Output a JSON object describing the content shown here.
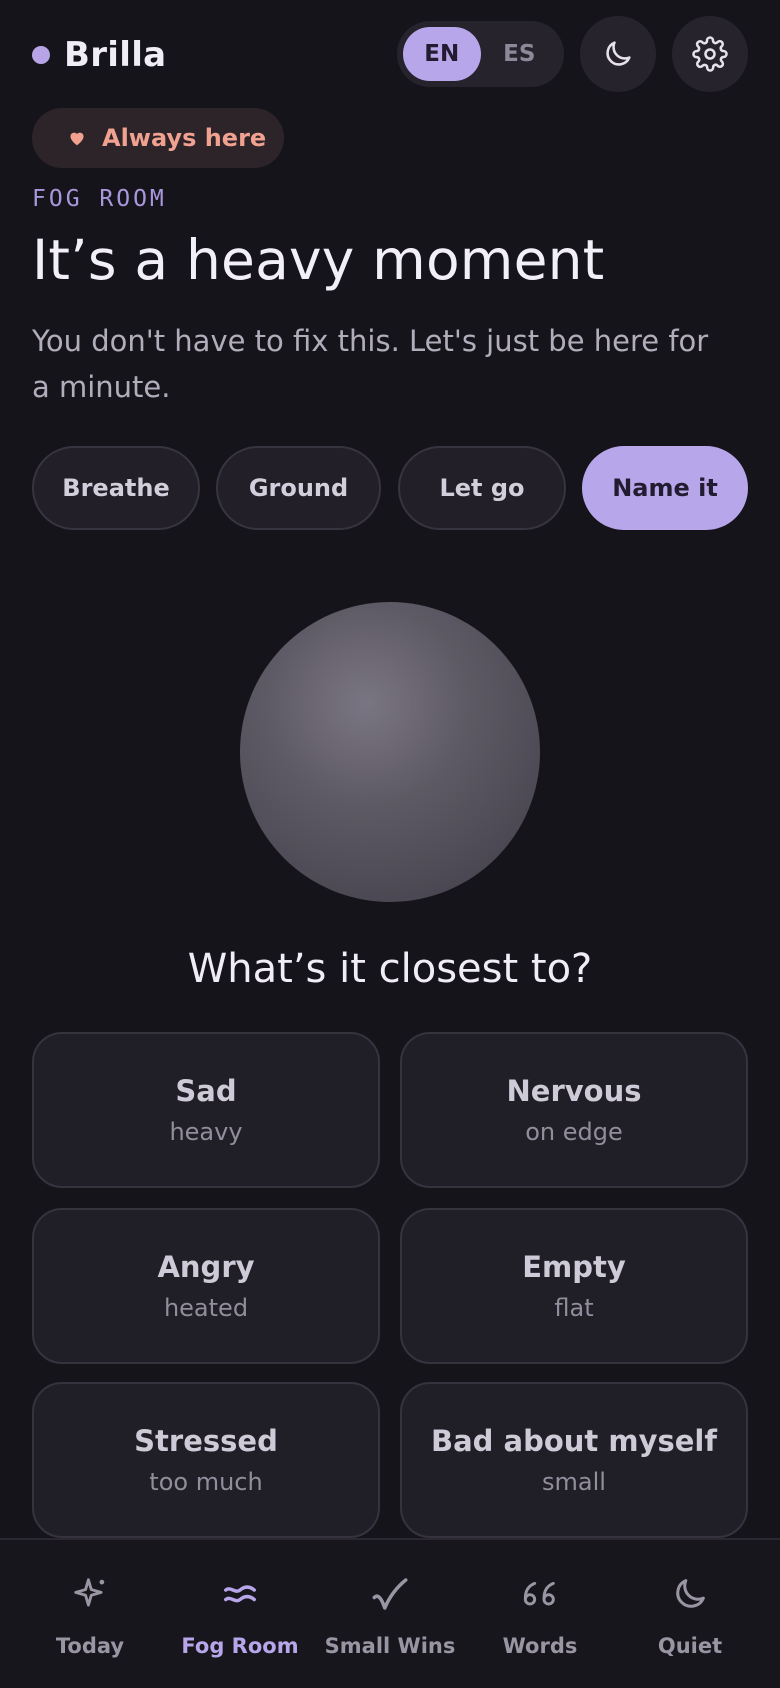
{
  "app": {
    "name": "Brilla"
  },
  "header": {
    "languages": [
      {
        "label": "EN",
        "active": true
      },
      {
        "label": "ES",
        "active": false
      }
    ],
    "theme_icon": "moon-icon",
    "settings_icon": "gear-icon"
  },
  "badge": {
    "icon": "heart-icon",
    "label": "Always here"
  },
  "room": {
    "eyebrow": "FOG ROOM",
    "title": "It’s a heavy moment",
    "subtitle": "You don't have to fix this. Let's just be here for a minute."
  },
  "tabs": [
    {
      "label": "Breathe",
      "active": false
    },
    {
      "label": "Ground",
      "active": false
    },
    {
      "label": "Let go",
      "active": false
    },
    {
      "label": "Name it",
      "active": true
    }
  ],
  "question": "What’s it closest to?",
  "feelings": [
    {
      "label": "Sad",
      "sub": "heavy"
    },
    {
      "label": "Nervous",
      "sub": "on edge"
    },
    {
      "label": "Angry",
      "sub": "heated"
    },
    {
      "label": "Empty",
      "sub": "flat"
    },
    {
      "label": "Stressed",
      "sub": "too much"
    },
    {
      "label": "Bad about myself",
      "sub": "small"
    }
  ],
  "nav": [
    {
      "label": "Today",
      "icon": "sparkle-icon",
      "active": false
    },
    {
      "label": "Fog Room",
      "icon": "waves-icon",
      "active": true
    },
    {
      "label": "Small Wins",
      "icon": "check-icon",
      "active": false
    },
    {
      "label": "Words",
      "icon": "quote-icon",
      "active": false
    },
    {
      "label": "Quiet",
      "icon": "moon-icon",
      "active": false
    }
  ],
  "colors": {
    "background": "#16141b",
    "accent": "#b8a6ea",
    "badge_text": "#f0a190"
  }
}
